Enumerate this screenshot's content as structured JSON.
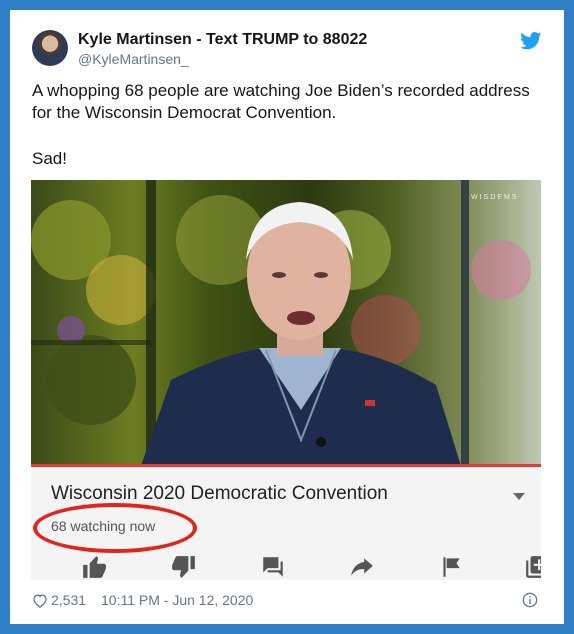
{
  "author": {
    "name": "Kyle Martinsen - Text TRUMP to 88022",
    "handle": "@KyleMartinsen_"
  },
  "tweet": {
    "text_line1": "A whopping 68 people are watching Joe Biden’s recorded address for the Wisconsin Democrat Convention.",
    "text_line2": "Sad!"
  },
  "embed": {
    "title": "Wisconsin 2020 Democratic Convention",
    "watching": "68 watching now",
    "watermark": "WISDEMS"
  },
  "footer": {
    "likes": "2,531",
    "timestamp": "10:11 PM - Jun 12, 2020"
  },
  "icons": {
    "bird": "twitter-bird-icon",
    "like": "heart-icon",
    "info": "info-icon",
    "actions": [
      "thumbs-up-icon",
      "thumbs-down-icon",
      "comment-icon",
      "share-icon",
      "flag-icon",
      "add-to-playlist-icon"
    ]
  },
  "colors": {
    "frame": "#2f7fc5",
    "twitter_blue": "#1da1f2",
    "highlight_circle": "#e0261b",
    "progress": "#e53935"
  }
}
